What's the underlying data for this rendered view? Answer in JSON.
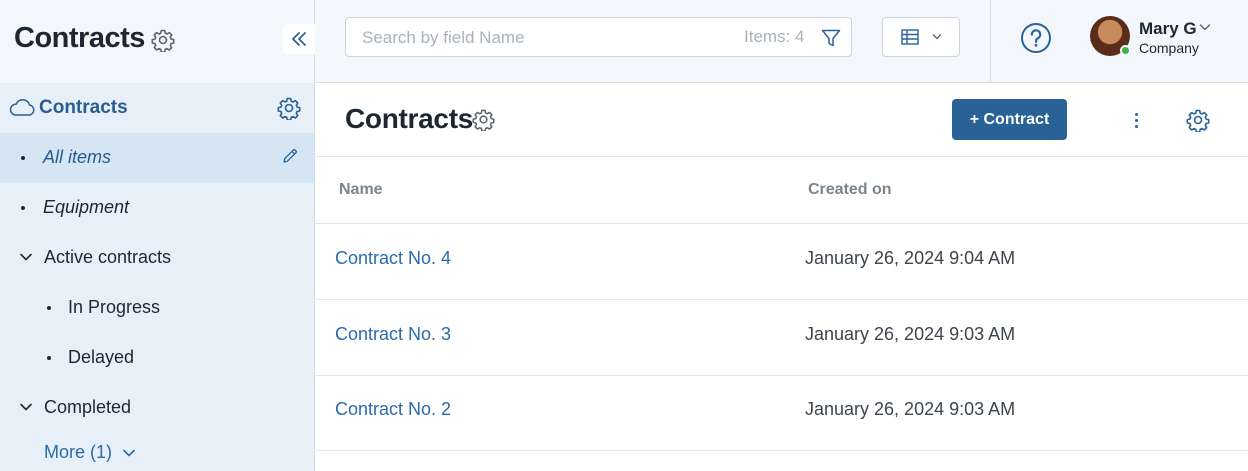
{
  "app": {
    "title": "Contracts"
  },
  "sidebar": {
    "section_label": "Contracts",
    "items": [
      {
        "label": "All items"
      },
      {
        "label": "Equipment"
      },
      {
        "label": "Active contracts"
      },
      {
        "label": "In Progress"
      },
      {
        "label": "Delayed"
      },
      {
        "label": "Completed"
      }
    ],
    "more_label": "More (1)"
  },
  "topbar": {
    "search_placeholder": "Search by field Name",
    "items_count": "Items: 4"
  },
  "user": {
    "name": "Mary G",
    "company": "Company"
  },
  "main": {
    "title": "Contracts",
    "add_button": "+ Contract"
  },
  "table": {
    "columns": [
      "Name",
      "Created on"
    ],
    "rows": [
      {
        "name": "Contract No. 4",
        "created": "January 26, 2024 9:04 AM"
      },
      {
        "name": "Contract No. 3",
        "created": "January 26, 2024 9:03 AM"
      },
      {
        "name": "Contract No. 2",
        "created": "January 26, 2024 9:03 AM"
      }
    ]
  },
  "colors": {
    "accent": "#286296",
    "link": "#2a6bab",
    "sidebar_bg": "#e7f0f8",
    "active_item_bg": "#d5e5f3",
    "online_status": "#3cb44b"
  },
  "icons": [
    "gear-icon",
    "collapse-double-chevron-icon",
    "cloud-icon",
    "edit-pencil-icon",
    "chevron-down-icon",
    "filter-icon",
    "table-view-icon",
    "help-icon",
    "kebab-menu-icon"
  ]
}
